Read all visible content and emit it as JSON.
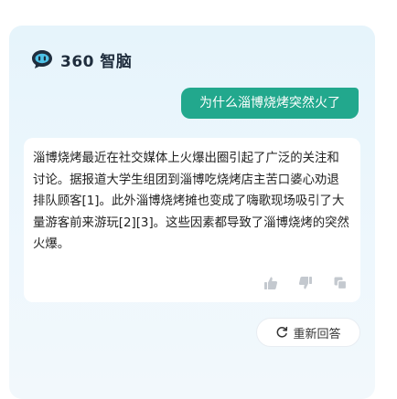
{
  "brand": {
    "name": "360 智脑",
    "logo_icon": "chat-bubble-logo-icon"
  },
  "conversation": {
    "user_message": "为什么淄博烧烤突然火了",
    "assistant_answer": "淄博烧烤最近在社交媒体上火爆出圈引起了广泛的关注和讨论。据报道大学生组团到淄博吃烧烤店主苦口婆心劝退排队顾客[1]。此外淄博烧烤摊也变成了嗨歌现场吸引了大量游客前来游玩[2][3]。这些因素都导致了淄博烧烤的突然火爆。"
  },
  "actions": {
    "like_icon": "thumbs-up-icon",
    "dislike_icon": "thumbs-down-icon",
    "copy_icon": "copy-icon"
  },
  "regenerate": {
    "label": "重新回答",
    "icon": "refresh-icon"
  },
  "colors": {
    "accent": "#22a88d",
    "panel_bg": "#e8f4fb",
    "card_bg": "#ffffff",
    "icon_gray": "#c4c9cf"
  }
}
